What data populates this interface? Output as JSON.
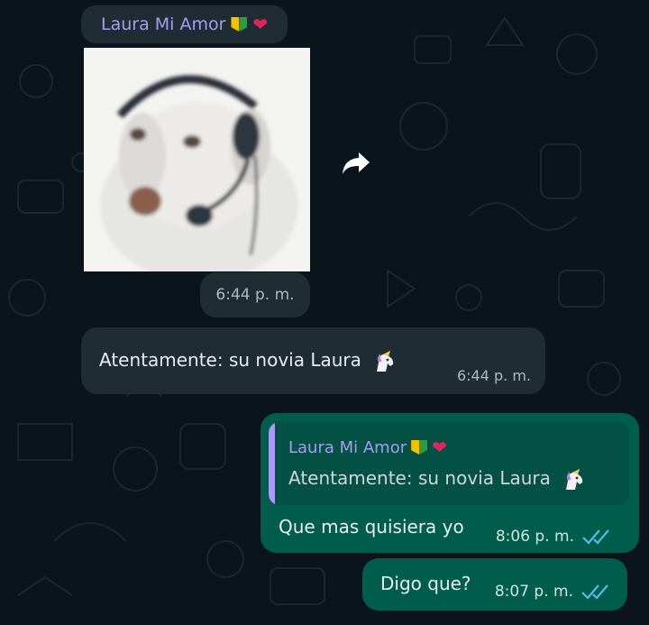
{
  "contact": {
    "name": "Laura Mi Amor"
  },
  "messages": {
    "photo": {
      "time": "6:44 p. m."
    },
    "incoming": {
      "text": "Atentamente: su novia Laura",
      "time": "6:44 p. m."
    },
    "reply": {
      "quoted_name": "Laura Mi Amor",
      "quoted_text": "Atentamente: su novia Laura",
      "text": "Que mas quisiera yo",
      "time": "8:06 p. m.",
      "status": "read"
    },
    "last": {
      "text": "Digo que?",
      "time": "8:07 p. m.",
      "status": "read"
    }
  },
  "colors": {
    "background": "#0b141a",
    "incoming_bubble": "#1f2c33",
    "outgoing_bubble": "#005c4b",
    "sender_name": "#a99bf4",
    "read_ticks": "#53bdeb"
  },
  "icons": [
    "forward-icon",
    "double-check-icon",
    "unicorn-emoji",
    "beginner-emoji",
    "heart-emoji"
  ]
}
